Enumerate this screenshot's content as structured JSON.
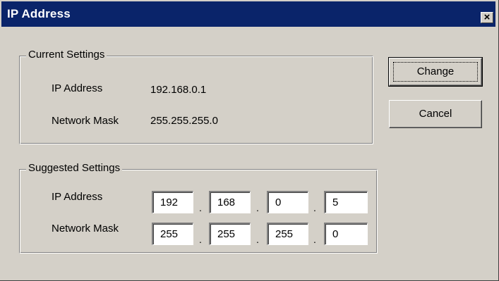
{
  "window": {
    "title": "IP Address",
    "close_glyph": "✕"
  },
  "current": {
    "group_label": "Current Settings",
    "ip_label": "IP Address",
    "ip_value": "192.168.0.1",
    "mask_label": "Network Mask",
    "mask_value": "255.255.255.0"
  },
  "suggested": {
    "group_label": "Suggested Settings",
    "ip_label": "IP Address",
    "ip_octets": [
      "192",
      "168",
      "0",
      "5"
    ],
    "mask_label": "Network Mask",
    "mask_octets": [
      "255",
      "255",
      "255",
      "0"
    ],
    "separator": "."
  },
  "buttons": {
    "change": "Change",
    "cancel": "Cancel"
  },
  "colors": {
    "titlebar": "#0a246a",
    "face": "#d4d0c8"
  }
}
